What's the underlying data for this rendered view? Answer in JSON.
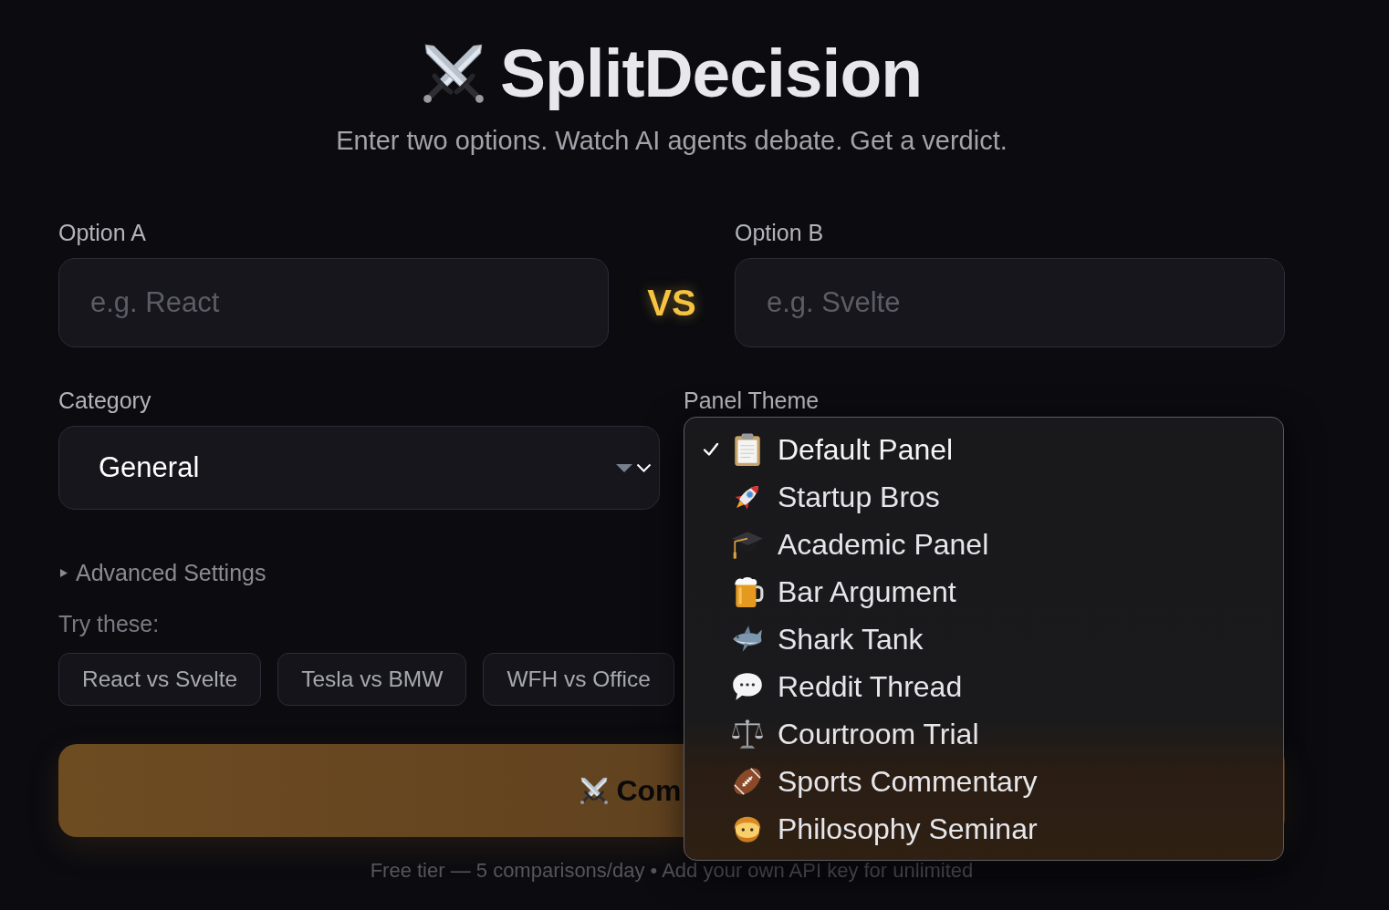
{
  "header": {
    "title": "SplitDecision",
    "subtitle": "Enter two options. Watch AI agents debate. Get a verdict."
  },
  "options": [
    {
      "label": "Option A",
      "placeholder": "e.g. React"
    },
    {
      "label": "Option B",
      "placeholder": "e.g. Svelte"
    }
  ],
  "versus": "VS",
  "category": {
    "label": "Category",
    "value": "General"
  },
  "panel_theme": {
    "label": "Panel Theme",
    "expanded": true,
    "options": [
      {
        "label": "Default Panel",
        "selected": true
      },
      {
        "label": "Startup Bros",
        "selected": false
      },
      {
        "label": "Academic Panel",
        "selected": false
      },
      {
        "label": "Bar Argument",
        "selected": false
      },
      {
        "label": "Shark Tank",
        "selected": false
      },
      {
        "label": "Reddit Thread",
        "selected": false
      },
      {
        "label": "Courtroom Trial",
        "selected": false
      },
      {
        "label": "Sports Commentary",
        "selected": false
      },
      {
        "label": "Philosophy Seminar",
        "selected": false
      }
    ]
  },
  "advanced_settings": {
    "label": "Advanced Settings",
    "expanded": false
  },
  "examples": {
    "label": "Try these:",
    "chips": [
      "React vs Svelte",
      "Tesla vs BMW",
      "WFH vs Office"
    ]
  },
  "compare_button": {
    "label": "Com"
  },
  "footer": "Free tier — 5 comparisons/day • Add your own API key for unlimited"
}
